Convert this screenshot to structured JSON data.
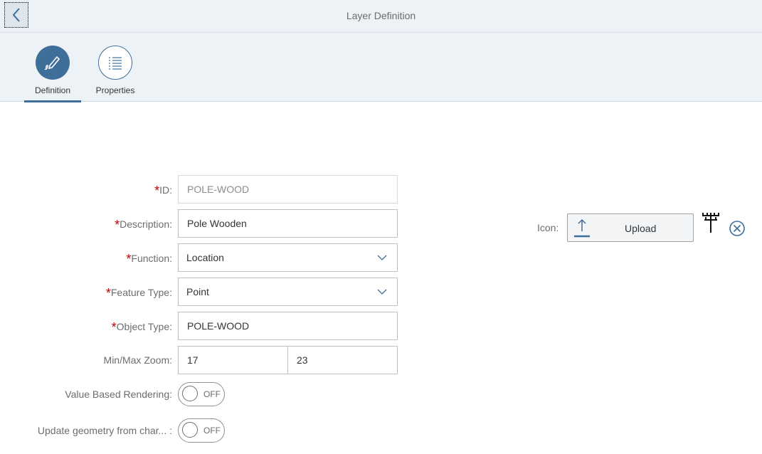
{
  "header": {
    "title": "Layer Definition",
    "back_icon": "chevron-left-icon"
  },
  "tabs": [
    {
      "label": "Definition",
      "icon": "pencil-icon",
      "active": true
    },
    {
      "label": "Properties",
      "icon": "list-icon",
      "active": false
    }
  ],
  "form": {
    "id": {
      "label": "ID:",
      "required": "*",
      "value": "POLE-WOOD"
    },
    "description": {
      "label": "Description:",
      "required": "*",
      "value": "Pole Wooden"
    },
    "function": {
      "label": "Function:",
      "required": "*",
      "value": "Location"
    },
    "feature_type": {
      "label": "Feature Type:",
      "required": "*",
      "value": "Point"
    },
    "object_type": {
      "label": "Object Type:",
      "required": "*",
      "value": "POLE-WOOD"
    },
    "zoom": {
      "label": "Min/Max Zoom:",
      "min": "17",
      "max": "23"
    },
    "value_based_rendering": {
      "label": "Value Based Rendering:",
      "state": "OFF"
    },
    "update_geometry": {
      "label": "Update geometry from char... :",
      "state": "OFF"
    }
  },
  "icon_panel": {
    "label": "Icon:",
    "upload_label": "Upload",
    "preview_icon": "utility-pole-icon",
    "remove_icon": "clear-circle-icon"
  },
  "colors": {
    "accent": "#3f6f99",
    "required": "#bb0000",
    "header_bg": "#edf2f7"
  }
}
